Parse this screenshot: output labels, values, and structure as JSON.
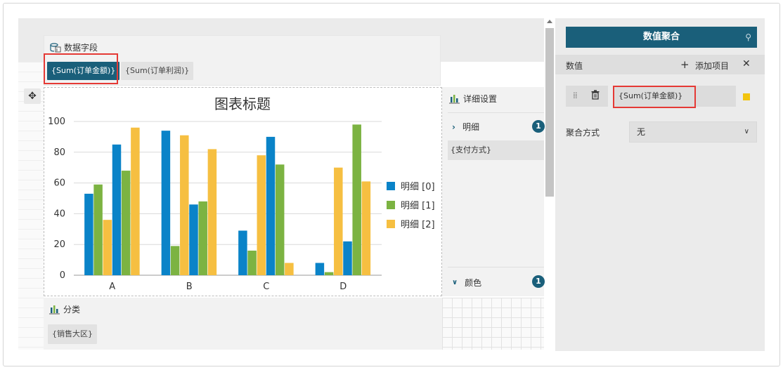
{
  "data_fields": {
    "title": "数据字段",
    "chips": [
      "{Sum(订单金额)}",
      "{Sum(订单利润)}"
    ]
  },
  "chart_data": {
    "type": "bar",
    "title": "图表标题",
    "categories": [
      "A",
      "B",
      "C",
      "D"
    ],
    "series": [
      {
        "name": "明细 [0]",
        "values": [
          53,
          94,
          29,
          8
        ]
      },
      {
        "name": "明细 [1]",
        "values": [
          59,
          19,
          16,
          2
        ]
      },
      {
        "name": "明细 [0]",
        "values": [
          36,
          91,
          78,
          70
        ]
      },
      {
        "name": "明细 [1]",
        "values": [
          85,
          46,
          90,
          22
        ]
      },
      {
        "name": "明细 [1]",
        "values": [
          68,
          48,
          72,
          98
        ]
      },
      {
        "name": "明细 [2]",
        "values": [
          96,
          82,
          8,
          61
        ]
      }
    ],
    "legend": [
      "明细 [0]",
      "明细 [1]",
      "明细 [2]"
    ],
    "colors": [
      "#0a83c8",
      "#7cb342",
      "#f6bf41"
    ],
    "ylim": [
      0,
      100
    ],
    "yticks": [
      "0",
      "20",
      "40",
      "60",
      "80",
      "100"
    ],
    "grid": true,
    "legend_position": "right"
  },
  "category": {
    "title": "分类",
    "chip": "{销售大区}"
  },
  "detail": {
    "title": "详细设置",
    "section1": "明细",
    "section1_count": "1",
    "field": "{支付方式}",
    "section2": "颜色",
    "section2_count": "1"
  },
  "panel": {
    "header": "数值聚合",
    "values_label": "数值",
    "add_label": "添加项目",
    "field": "{Sum(订单金额)}",
    "agg_label": "聚合方式",
    "agg_value": "无",
    "marker_color": "#f2c40f",
    "accent": "#1a5f7a"
  }
}
